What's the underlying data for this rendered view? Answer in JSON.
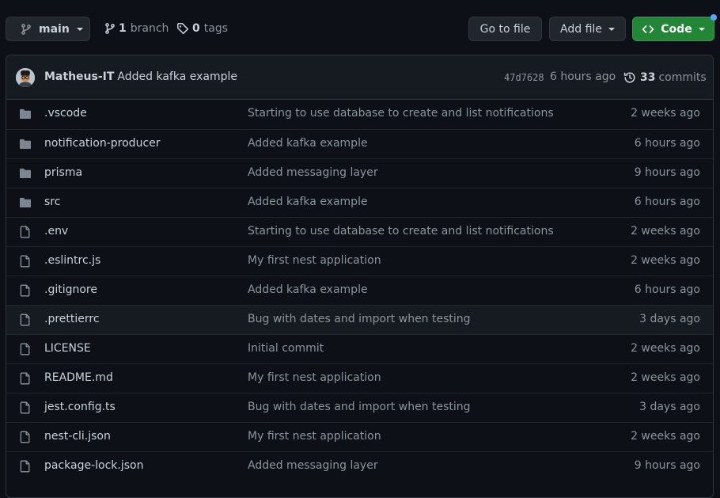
{
  "branch_selector": {
    "label": "main"
  },
  "branches": {
    "count": "1",
    "label": "branch"
  },
  "tags": {
    "count": "0",
    "label": "tags"
  },
  "actions": {
    "go_to_file": "Go to file",
    "add_file": "Add file",
    "code": "Code"
  },
  "colors": {
    "code_button": "#238636",
    "notification_dot": "#58a6ff",
    "folder": "#7d8590",
    "background": "#0d1117"
  },
  "latest_commit": {
    "author": "Matheus-IT",
    "message": "Added kafka example",
    "sha": "47d7628",
    "time": "6 hours ago",
    "commit_count": "33",
    "commit_label": "commits"
  },
  "files": [
    {
      "type": "folder",
      "name": ".vscode",
      "message": "Starting to use database to create and list notifications",
      "age": "2 weeks ago"
    },
    {
      "type": "folder",
      "name": "notification-producer",
      "message": "Added kafka example",
      "age": "6 hours ago"
    },
    {
      "type": "folder",
      "name": "prisma",
      "message": "Added messaging layer",
      "age": "9 hours ago"
    },
    {
      "type": "folder",
      "name": "src",
      "message": "Added kafka example",
      "age": "6 hours ago"
    },
    {
      "type": "file",
      "name": ".env",
      "message": "Starting to use database to create and list notifications",
      "age": "2 weeks ago"
    },
    {
      "type": "file",
      "name": ".eslintrc.js",
      "message": "My first nest application",
      "age": "2 weeks ago"
    },
    {
      "type": "file",
      "name": ".gitignore",
      "message": "Added kafka example",
      "age": "6 hours ago"
    },
    {
      "type": "file",
      "name": ".prettierrc",
      "message": "Bug with dates and import when testing",
      "age": "3 days ago"
    },
    {
      "type": "file",
      "name": "LICENSE",
      "message": "Initial commit",
      "age": "2 weeks ago"
    },
    {
      "type": "file",
      "name": "README.md",
      "message": "My first nest application",
      "age": "2 weeks ago"
    },
    {
      "type": "file",
      "name": "jest.config.ts",
      "message": "Bug with dates and import when testing",
      "age": "3 days ago"
    },
    {
      "type": "file",
      "name": "nest-cli.json",
      "message": "My first nest application",
      "age": "2 weeks ago"
    },
    {
      "type": "file",
      "name": "package-lock.json",
      "message": "Added messaging layer",
      "age": "9 hours ago"
    }
  ]
}
